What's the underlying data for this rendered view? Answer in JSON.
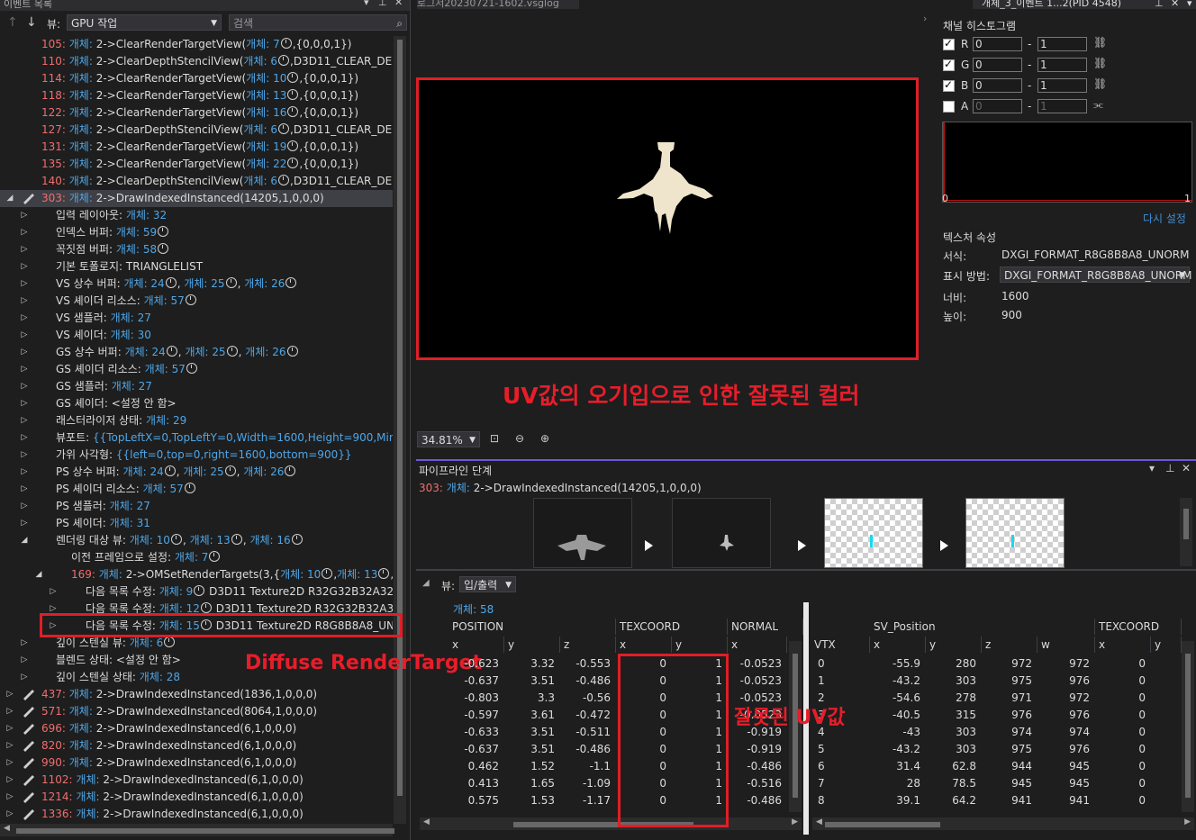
{
  "left_panel": {
    "title": "이벤트 목록",
    "view_label": "뷰:",
    "view_value": "GPU 작업",
    "search_placeholder": "검색",
    "rows": [
      {
        "num": "105:",
        "pre": " 개체: 2->ClearRenderTargetView(",
        "obj": "개체: 7",
        "post": ",{0,0,0,1})"
      },
      {
        "num": "110:",
        "pre": " 개체: 2->ClearDepthStencilView(",
        "obj": "개체: 6",
        "post": ",D3D11_CLEAR_DEPTH,"
      },
      {
        "num": "114:",
        "pre": " 개체: 2->ClearRenderTargetView(",
        "obj": "개체: 10",
        "post": ",{0,0,0,1})"
      },
      {
        "num": "118:",
        "pre": " 개체: 2->ClearRenderTargetView(",
        "obj": "개체: 13",
        "post": ",{0,0,0,1})"
      },
      {
        "num": "122:",
        "pre": " 개체: 2->ClearRenderTargetView(",
        "obj": "개체: 16",
        "post": ",{0,0,0,1})"
      },
      {
        "num": "127:",
        "pre": " 개체: 2->ClearDepthStencilView(",
        "obj": "개체: 6",
        "post": ",D3D11_CLEAR_DEPTH,"
      },
      {
        "num": "131:",
        "pre": " 개체: 2->ClearRenderTargetView(",
        "obj": "개체: 19",
        "post": ",{0,0,0,1})"
      },
      {
        "num": "135:",
        "pre": " 개체: 2->ClearRenderTargetView(",
        "obj": "개체: 22",
        "post": ",{0,0,0,1})"
      },
      {
        "num": "140:",
        "pre": " 개체: 2->ClearDepthStencilView(",
        "obj": "개체: 6",
        "post": ",D3D11_CLEAR_DEPTH,"
      },
      {
        "num": "303:",
        "pre": " 개체: 2->DrawIndexedInstanced(14205,1,0,0,0)",
        "obj": "",
        "post": ""
      },
      {
        "label": "입력 레이아웃:",
        "objs": [
          "개체: 32"
        ],
        "clock": false
      },
      {
        "label": "인덱스 버퍼:",
        "objs": [
          "개체: 59"
        ],
        "clock": true
      },
      {
        "label": "꼭짓점 버퍼:",
        "objs": [
          "개체: 58"
        ],
        "clock": true
      },
      {
        "label": "기본 토폴로지: TRIANGLELIST",
        "objs": [],
        "clock": false
      },
      {
        "label": "VS 상수 버퍼:",
        "objs": [
          "개체: 24",
          "개체: 25",
          "개체: 26"
        ],
        "clock": true
      },
      {
        "label": "VS 셰이더 리소스:",
        "objs": [
          "개체: 57"
        ],
        "clock": true
      },
      {
        "label": "VS 샘플러:",
        "objs": [
          "개체: 27"
        ],
        "clock": false
      },
      {
        "label": "VS 셰이더:",
        "objs": [
          "개체: 30"
        ],
        "clock": false
      },
      {
        "label": "GS 상수 버퍼:",
        "objs": [
          "개체: 24",
          "개체: 25",
          "개체: 26"
        ],
        "clock": true
      },
      {
        "label": "GS 셰이더 리소스:",
        "objs": [
          "개체: 57"
        ],
        "clock": true
      },
      {
        "label": "GS 샘플러:",
        "objs": [
          "개체: 27"
        ],
        "clock": false
      },
      {
        "label": "GS 셰이더: <설정 안 함>",
        "objs": [],
        "clock": false
      },
      {
        "label": "래스터라이저 상태:",
        "objs": [
          "개체: 29"
        ],
        "clock": false
      },
      {
        "label": "뷰포트:",
        "objs": [
          "{{TopLeftX=0,TopLeftY=0,Width=1600,Height=900,MinDepth"
        ],
        "clock": false
      },
      {
        "label": "가위 사각형:",
        "objs": [
          "{{left=0,top=0,right=1600,bottom=900}}"
        ],
        "clock": false
      },
      {
        "label": "PS 상수 버퍼:",
        "objs": [
          "개체: 24",
          "개체: 25",
          "개체: 26"
        ],
        "clock": true
      },
      {
        "label": "PS 셰이더 리소스:",
        "objs": [
          "개체: 57"
        ],
        "clock": true
      },
      {
        "label": "PS 샘플러:",
        "objs": [
          "개체: 27"
        ],
        "clock": false
      },
      {
        "label": "PS 셰이더:",
        "objs": [
          "개체: 31"
        ],
        "clock": false
      },
      {
        "label": "렌더링 대상 뷰:",
        "objs": [
          "개체: 10",
          "개체: 13",
          "개체: 16"
        ],
        "clock": true
      },
      {
        "label": "이전 프레임으로 설정:",
        "objs": [
          "개체: 7"
        ],
        "clock": true
      },
      {
        "label": "169: 개체: 2->OMSetRenderTargets(3,{개체: 10",
        "objs": [
          "개체: 13",
          "개체"
        ],
        "clock": true
      },
      {
        "label": "다음 목록 수정:",
        "objs": [
          "개체: 9"
        ],
        "clock": true,
        "tail": " D3D11 Texture2D R32G32B32A32_"
      },
      {
        "label": "다음 목록 수정:",
        "objs": [
          "개체: 12"
        ],
        "clock": true,
        "tail": " D3D11 Texture2D R32G32B32A32_"
      },
      {
        "label": "다음 목록 수정:",
        "objs": [
          "개체: 15"
        ],
        "clock": true,
        "tail": " D3D11 Texture2D R8G8B8A8_UNC"
      },
      {
        "label": "깊이 스텐실 뷰:",
        "objs": [
          "개체: 6"
        ],
        "clock": true
      },
      {
        "label": "블렌드 상태: <설정 안 함>",
        "objs": [],
        "clock": false
      },
      {
        "label": "깊이 스텐실 상태:",
        "objs": [
          "개체: 28"
        ],
        "clock": false
      },
      {
        "num": "437:",
        "pre": " 개체: 2->DrawIndexedInstanced(1836,1,0,0,0)",
        "obj": "",
        "post": ""
      },
      {
        "num": "571:",
        "pre": " 개체: 2->DrawIndexedInstanced(8064,1,0,0,0)",
        "obj": "",
        "post": ""
      },
      {
        "num": "696:",
        "pre": " 개체: 2->DrawIndexedInstanced(6,1,0,0,0)",
        "obj": "",
        "post": ""
      },
      {
        "num": "820:",
        "pre": " 개체: 2->DrawIndexedInstanced(6,1,0,0,0)",
        "obj": "",
        "post": ""
      },
      {
        "num": "990:",
        "pre": " 개체: 2->DrawIndexedInstanced(6,1,0,0,0)",
        "obj": "",
        "post": ""
      },
      {
        "num": "1102:",
        "pre": " 개체: 2->DrawIndexedInstanced(6,1,0,0,0)",
        "obj": "",
        "post": ""
      },
      {
        "num": "1214:",
        "pre": " 개체: 2->DrawIndexedInstanced(6,1,0,0,0)",
        "obj": "",
        "post": ""
      },
      {
        "num": "1336:",
        "pre": " 개체: 2->DrawIndexedInstanced(6,1,0,0,0)",
        "obj": "",
        "post": ""
      }
    ]
  },
  "doc_tab": "로그서20230721-1602.vsglog",
  "right_tab": "개체_3_이벤트 1...2(PID 4548)",
  "viewport": {
    "annotation": "UV값의 오기입으로 인한 잘못된 컬러",
    "zoom": "34.81%"
  },
  "channel": {
    "title": "채널 히스토그램",
    "rows": [
      {
        "name": "R",
        "min": "0",
        "max": "1",
        "checked": true
      },
      {
        "name": "G",
        "min": "0",
        "max": "1",
        "checked": true
      },
      {
        "name": "B",
        "min": "0",
        "max": "1",
        "checked": true
      },
      {
        "name": "A",
        "min": "0",
        "max": "1",
        "checked": false
      }
    ],
    "hist_min": "0",
    "hist_max": "1",
    "reset": "다시 설정",
    "props_title": "텍스처 속성",
    "format_label": "서식:",
    "format_value": "DXGI_FORMAT_R8G8B8A8_UNORM",
    "display_label": "표시 방법:",
    "display_value": "DXGI_FORMAT_R8G8B8A8_UNORM",
    "width_label": "너비:",
    "width_value": "1600",
    "height_label": "높이:",
    "height_value": "900"
  },
  "pipeline": {
    "title": "파이프라인 단계",
    "event_num": "303:",
    "event_obj": "개체:",
    "event_rest": " 2->DrawIndexedInstanced(14205,1,0,0,0)"
  },
  "io": {
    "view_label": "뷰:",
    "view_value": "입/출력",
    "object": "개체: 58",
    "left_groups": [
      "POSITION",
      "TEXCOORD",
      "NORMAL"
    ],
    "left_cols": [
      "x",
      "y",
      "z",
      "x",
      "y",
      "x"
    ],
    "left_rows": [
      [
        "-0.623",
        "3.32",
        "-0.553",
        "0",
        "1",
        "-0.0523"
      ],
      [
        "-0.637",
        "3.51",
        "-0.486",
        "0",
        "1",
        "-0.0523"
      ],
      [
        "-0.803",
        "3.3",
        "-0.56",
        "0",
        "1",
        "-0.0523"
      ],
      [
        "-0.597",
        "3.61",
        "-0.472",
        "0",
        "1",
        "-0.0523"
      ],
      [
        "-0.633",
        "3.51",
        "-0.511",
        "0",
        "1",
        "-0.919"
      ],
      [
        "-0.637",
        "3.51",
        "-0.486",
        "0",
        "1",
        "-0.919"
      ],
      [
        "0.462",
        "1.52",
        "-1.1",
        "0",
        "1",
        "-0.486"
      ],
      [
        "0.413",
        "1.65",
        "-1.09",
        "0",
        "1",
        "-0.516"
      ],
      [
        "0.575",
        "1.53",
        "-1.17",
        "0",
        "1",
        "-0.486"
      ]
    ],
    "right_groups": [
      "SV_Position",
      "TEXCOORD"
    ],
    "right_cols": [
      "VTX",
      "x",
      "y",
      "z",
      "w",
      "x",
      "y"
    ],
    "right_rows": [
      [
        "0",
        "-55.9",
        "280",
        "972",
        "972",
        "0"
      ],
      [
        "1",
        "-43.2",
        "303",
        "975",
        "976",
        "0"
      ],
      [
        "2",
        "-54.6",
        "278",
        "971",
        "972",
        "0"
      ],
      [
        "3",
        "-40.5",
        "315",
        "976",
        "976",
        "0"
      ],
      [
        "4",
        "-43",
        "303",
        "974",
        "974",
        "0"
      ],
      [
        "5",
        "-43.2",
        "303",
        "975",
        "976",
        "0"
      ],
      [
        "6",
        "31.4",
        "62.8",
        "944",
        "945",
        "0"
      ],
      [
        "7",
        "28",
        "78.5",
        "945",
        "945",
        "0"
      ],
      [
        "8",
        "39.1",
        "64.2",
        "941",
        "941",
        "0"
      ]
    ]
  },
  "annotations": {
    "diffuse": "Diffuse RenderTarget",
    "wrong_uv": "잘못된 UV값"
  }
}
